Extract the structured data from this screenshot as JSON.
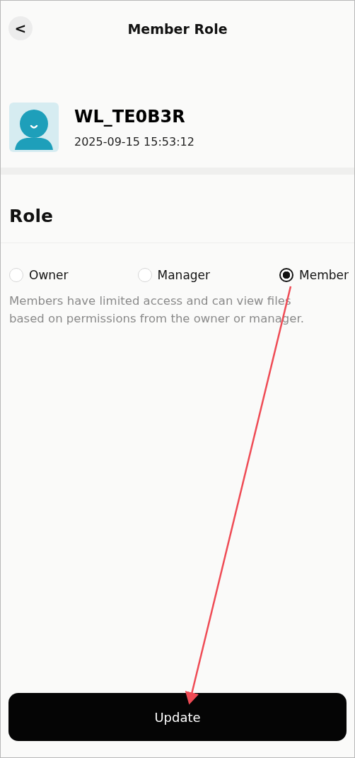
{
  "header": {
    "back": "<",
    "title": "Member Role"
  },
  "profile": {
    "name": "WL_TE0B3R",
    "date": "2025-09-15 15:53:12"
  },
  "role_section": {
    "heading": "Role",
    "options": [
      {
        "label": "Owner",
        "selected": false
      },
      {
        "label": "Manager",
        "selected": false
      },
      {
        "label": "Member",
        "selected": true
      }
    ],
    "description": "Members have limited access and can view files based on permissions from the owner or manager."
  },
  "button": "Update"
}
